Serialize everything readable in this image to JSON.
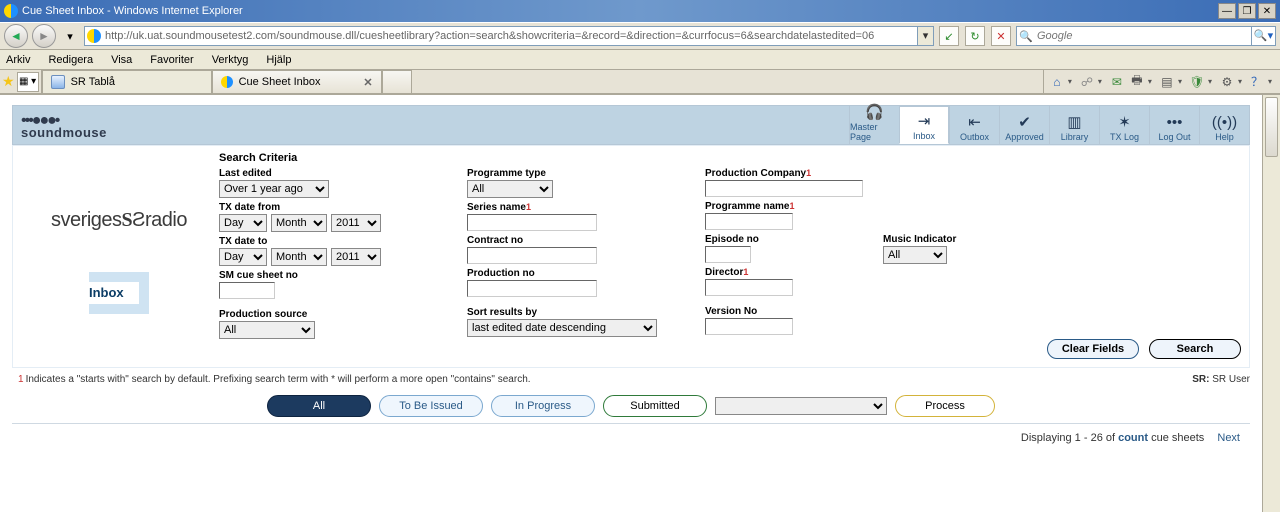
{
  "window": {
    "title": "Cue Sheet Inbox - Windows Internet Explorer"
  },
  "address": {
    "url": "http://uk.uat.soundmousetest2.com/soundmouse.dll/cuesheetlibrary?action=search&showcriteria=&record=&direction=&currfocus=6&searchdatelastedited=06"
  },
  "search_engine": {
    "placeholder": "Google"
  },
  "menu": {
    "arkiv": "Arkiv",
    "redigera": "Redigera",
    "visa": "Visa",
    "favoriter": "Favoriter",
    "verktyg": "Verktyg",
    "hjalp": "Hjälp"
  },
  "tabs": {
    "t1": "SR Tablå",
    "t2": "Cue Sheet Inbox"
  },
  "brand": {
    "dots": "•••●●●•",
    "name": "soundmouse"
  },
  "nav": {
    "master": "Master Page",
    "inbox": "Inbox",
    "outbox": "Outbox",
    "approved": "Approved",
    "library": "Library",
    "txlog": "TX Log",
    "logout": "Log Out",
    "help": "Help"
  },
  "leftlogo": {
    "text": "sveriges   radio",
    "inbox": "Inbox"
  },
  "form": {
    "heading": "Search Criteria",
    "last_edited": {
      "label": "Last edited",
      "value": "Over 1 year ago"
    },
    "tx_from": {
      "label": "TX date from",
      "day": "Day",
      "month": "Month",
      "year": "2011"
    },
    "tx_to": {
      "label": "TX date to",
      "day": "Day",
      "month": "Month",
      "year": "2011"
    },
    "sm_no": {
      "label": "SM cue sheet no"
    },
    "prod_src": {
      "label": "Production source",
      "value": "All"
    },
    "prog_type": {
      "label": "Programme type",
      "value": "All"
    },
    "series": {
      "label": "Series name"
    },
    "contract": {
      "label": "Contract no"
    },
    "prod_no": {
      "label": "Production no"
    },
    "sort": {
      "label": "Sort results by",
      "value": "last edited date descending"
    },
    "prod_co": {
      "label": "Production Company"
    },
    "prog_name": {
      "label": "Programme name"
    },
    "episode": {
      "label": "Episode no"
    },
    "director": {
      "label": "Director"
    },
    "version": {
      "label": "Version No"
    },
    "music_ind": {
      "label": "Music Indicator",
      "value": "All"
    },
    "clear": "Clear Fields",
    "search": "Search"
  },
  "footnote": {
    "sup": "1",
    "text": "Indicates a \"starts with\" search by default. Prefixing search term with * will perform a more open \"contains\" search.",
    "userlabel": "SR:",
    "username": "SR User"
  },
  "filter": {
    "all": "All",
    "tobeissued": "To Be Issued",
    "inprogress": "In Progress",
    "submitted": "Submitted",
    "process": "Process"
  },
  "results": {
    "prefix": "Displaying 1 - 26 of ",
    "count": "count",
    "suffix": " cue sheets",
    "next": "Next"
  }
}
